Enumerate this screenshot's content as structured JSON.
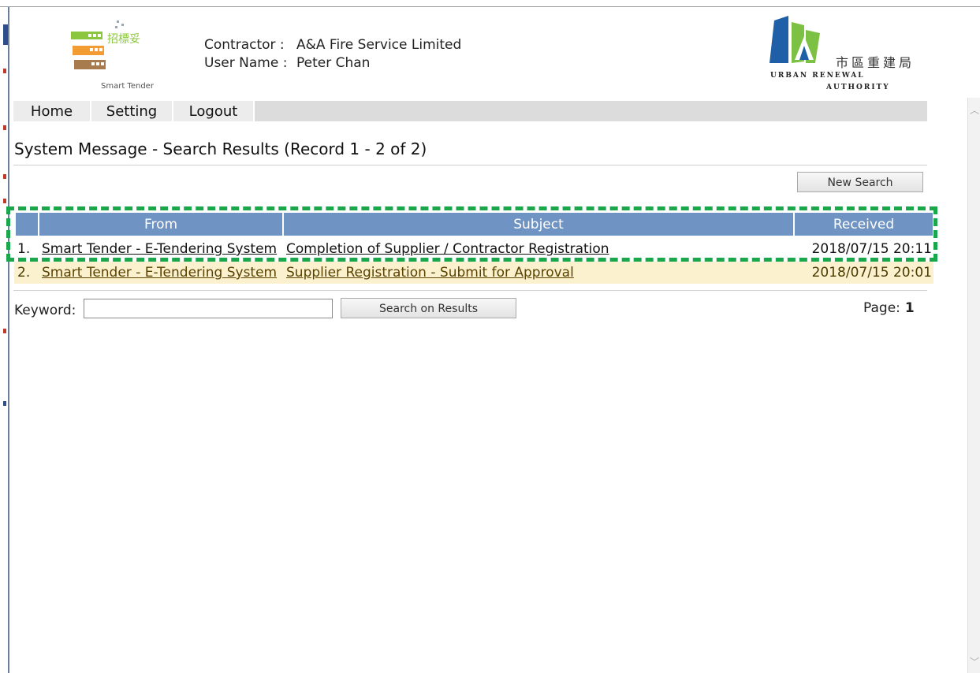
{
  "header": {
    "logo_left_cn": "招標妥",
    "logo_left_en": "Smart Tender",
    "contractor_label": "Contractor :",
    "contractor_value": "A&A Fire Service Limited",
    "username_label": "User Name :",
    "username_value": "Peter Chan",
    "ura_cn": "市區重建局",
    "ura_en_line1": "URBAN RENEWAL",
    "ura_en_line2": "AUTHORITY"
  },
  "menu": {
    "home": "Home",
    "setting": "Setting",
    "logout": "Logout"
  },
  "page_title": "System Message - Search Results (Record 1 - 2 of 2)",
  "buttons": {
    "new_search": "New Search",
    "search_on_results": "Search on Results"
  },
  "table": {
    "headers": {
      "from": "From",
      "subject": "Subject",
      "received": "Received"
    },
    "rows": [
      {
        "num": "1.",
        "from": "Smart Tender - E-Tendering System",
        "subject": "Completion of Supplier / Contractor Registration",
        "received": "2018/07/15 20:11"
      },
      {
        "num": "2.",
        "from": "Smart Tender - E-Tendering System",
        "subject": "Supplier Registration - Submit for Approval",
        "received": "2018/07/15 20:01"
      }
    ]
  },
  "keyword": {
    "label": "Keyword:",
    "value": ""
  },
  "pagination": {
    "label": "Page:",
    "current": "1"
  },
  "colors": {
    "header_blue": "#6f93c3",
    "highlight_green": "#1aa64a",
    "row_alt": "#fbf1cf"
  }
}
